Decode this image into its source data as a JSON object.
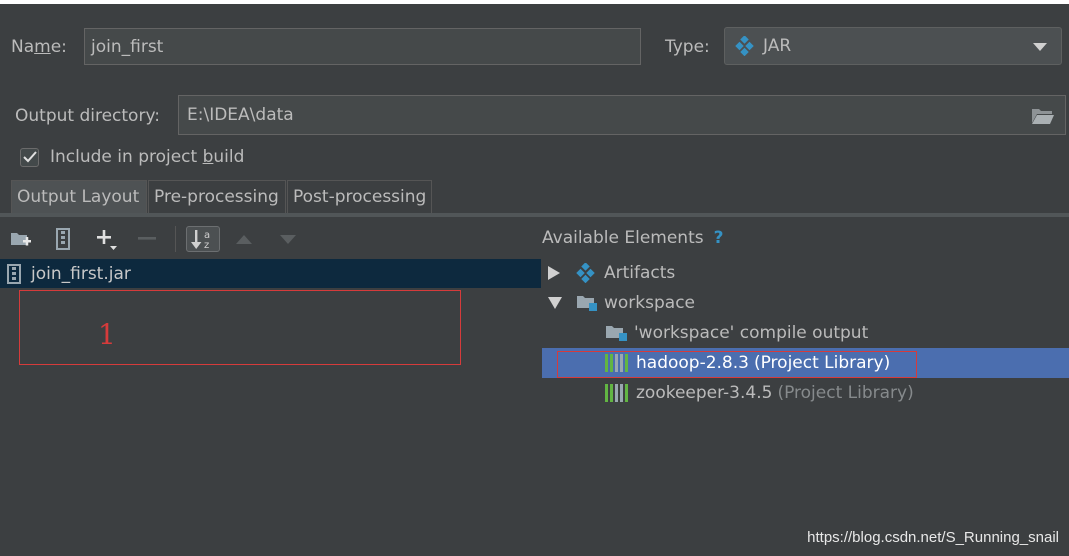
{
  "form": {
    "name_label": "Name:",
    "name_value": "join_first",
    "type_label": "Type:",
    "type_value": "JAR",
    "output_dir_label": "Output directory:",
    "output_dir_value": "E:\\IDEA\\data",
    "include_label": "Include in project build",
    "include_checked": true
  },
  "tabs": [
    {
      "label": "Output Layout",
      "selected": true
    },
    {
      "label": "Pre-processing",
      "selected": false
    },
    {
      "label": "Post-processing",
      "selected": false
    }
  ],
  "left_tree": {
    "root": "join_first.jar",
    "annotation_number": "1"
  },
  "right_panel": {
    "title": "Available Elements",
    "help": "?",
    "items": [
      {
        "label": "Artifacts",
        "suffix": ""
      },
      {
        "label": "workspace",
        "suffix": ""
      },
      {
        "label": "'workspace' compile output",
        "suffix": ""
      },
      {
        "label": "hadoop-2.8.3",
        "suffix": "(Project Library)"
      },
      {
        "label": "zookeeper-3.4.5",
        "suffix": "(Project Library)"
      }
    ]
  },
  "colors": {
    "background": "#3c3f41",
    "selection": "#4b6eaf",
    "tree_selection": "#0d293e",
    "annotation": "#d63b3b",
    "accent_blue": "#3592c4"
  },
  "watermark": "https://blog.csdn.net/S_Running_snail"
}
